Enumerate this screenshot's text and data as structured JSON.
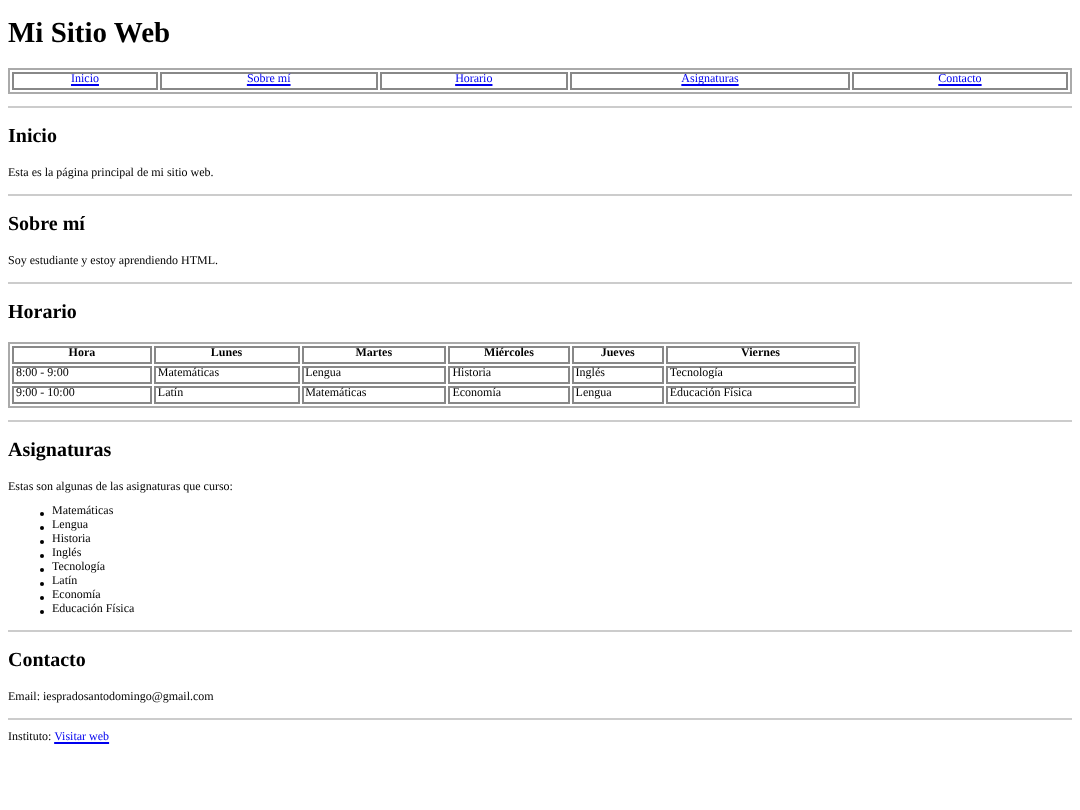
{
  "title": "Mi Sitio Web",
  "nav": [
    "Inicio",
    "Sobre mí",
    "Horario",
    "Asignaturas",
    "Contacto"
  ],
  "sections": [
    {
      "kind": "text",
      "heading": "Inicio",
      "text": "Esta es la página principal de mi sitio web."
    },
    {
      "kind": "text",
      "heading": "Sobre mí",
      "text": "Soy estudiante y estoy aprendiendo HTML."
    },
    {
      "kind": "table",
      "heading": "Horario",
      "columns": [
        "Hora",
        "Lunes",
        "Martes",
        "Miércoles",
        "Jueves",
        "Viernes"
      ],
      "rows": [
        [
          "8:00 - 9:00",
          "Matemáticas",
          "Lengua",
          "Historia",
          "Inglés",
          "Tecnología"
        ],
        [
          "9:00 - 10:00",
          "Latín",
          "Matemáticas",
          "Economía",
          "Lengua",
          "Educación Física"
        ]
      ]
    },
    {
      "kind": "list",
      "heading": "Asignaturas",
      "text": "Estas son algunas de las asignaturas que curso:",
      "items": [
        "Matemáticas",
        "Lengua",
        "Historia",
        "Inglés",
        "Tecnología",
        "Latín",
        "Economía",
        "Educación Física"
      ]
    },
    {
      "kind": "text",
      "heading": "Contacto",
      "text": "Email: iespradosantodomingo@gmail.com"
    }
  ],
  "footer": {
    "label": "Instituto:",
    "link": "Visitar web"
  }
}
